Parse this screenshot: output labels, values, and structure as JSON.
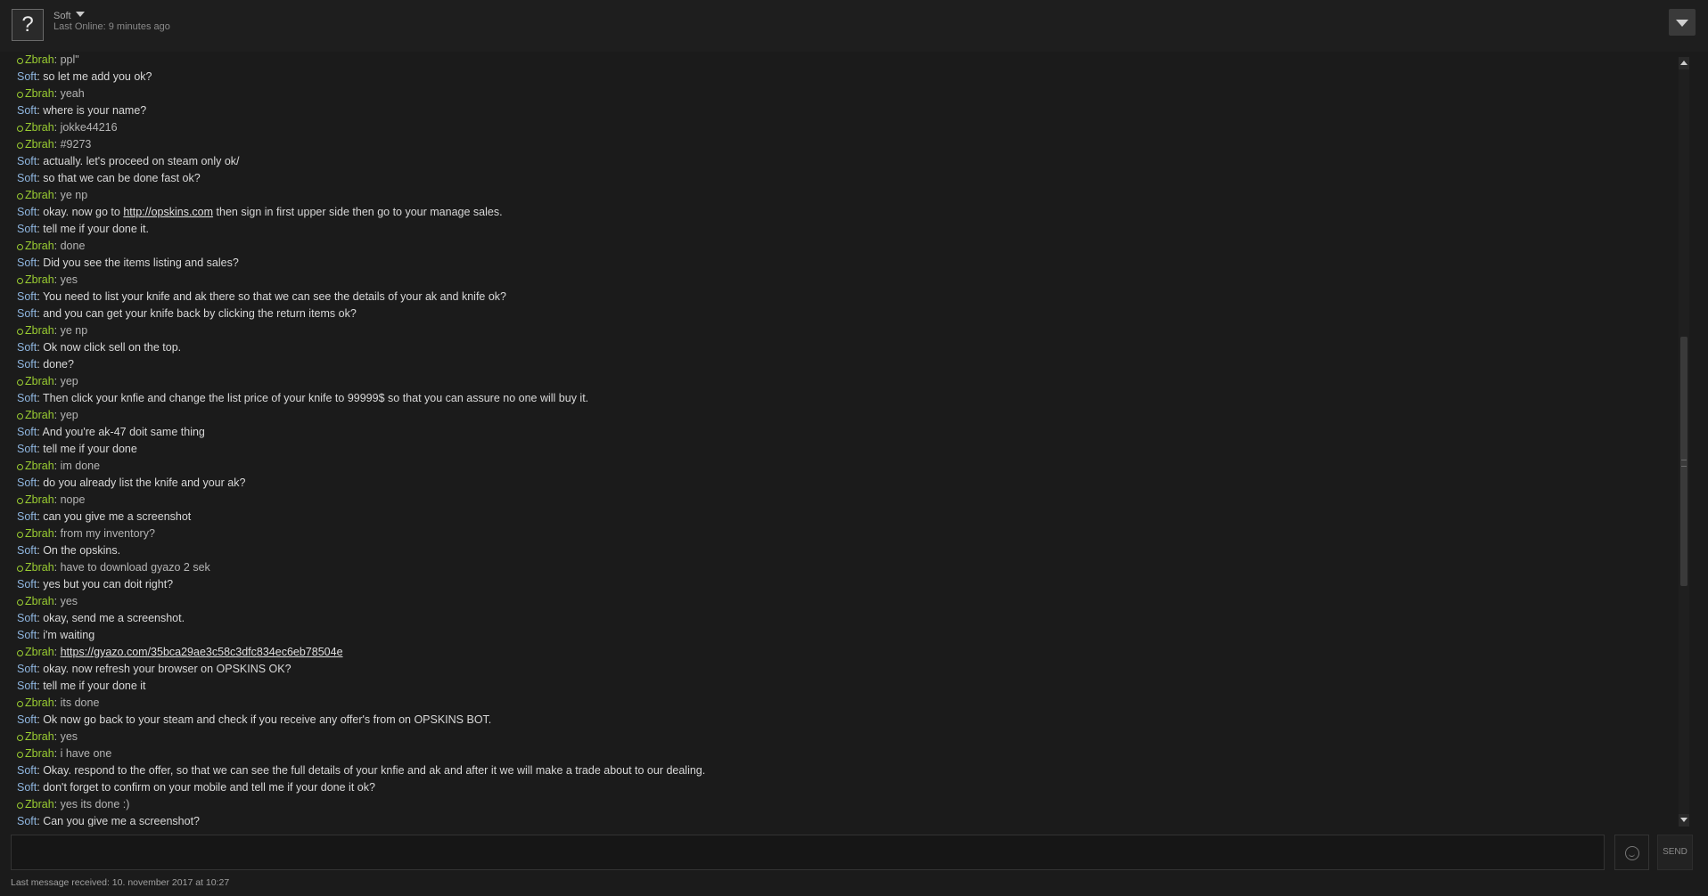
{
  "header": {
    "friend_name": "Soft",
    "last_online": "Last Online: 9 minutes ago",
    "avatar_glyph": "?"
  },
  "colors": {
    "background": "#1b1b1b",
    "sender_soft": "#8fb6e0",
    "sender_zbrah": "#9acd32",
    "text": "#d8d8d8"
  },
  "messages": [
    {
      "sender": "Zbrah",
      "text": "ppl\""
    },
    {
      "sender": "Soft",
      "text": "so let me add you ok?"
    },
    {
      "sender": "Zbrah",
      "text": "yeah"
    },
    {
      "sender": "Soft",
      "text": "where is your name?"
    },
    {
      "sender": "Zbrah",
      "text": "jokke44216"
    },
    {
      "sender": "Zbrah",
      "text": "#9273"
    },
    {
      "sender": "Soft",
      "text": "actually. let's proceed on steam only ok/"
    },
    {
      "sender": "Soft",
      "text": "so that we can be done fast ok?"
    },
    {
      "sender": "Zbrah",
      "text": "ye np"
    },
    {
      "sender": "Soft",
      "pre": "okay. now go to ",
      "link": "http://opskins.com",
      "post": " then sign in first upper side then go to your manage sales."
    },
    {
      "sender": "Soft",
      "text": "tell me if your done it."
    },
    {
      "sender": "Zbrah",
      "text": "done"
    },
    {
      "sender": "Soft",
      "text": "Did you see the items listing and sales?"
    },
    {
      "sender": "Zbrah",
      "text": "yes"
    },
    {
      "sender": "Soft",
      "text": "You need to list your knife and ak there so that we can see the details of your ak and knife ok?"
    },
    {
      "sender": "Soft",
      "text": "and you can get your knife back by clicking the return items ok?"
    },
    {
      "sender": "Zbrah",
      "text": "ye np"
    },
    {
      "sender": "Soft",
      "text": "Ok now click sell on the top."
    },
    {
      "sender": "Soft",
      "text": "done?"
    },
    {
      "sender": "Zbrah",
      "text": "yep"
    },
    {
      "sender": "Soft",
      "text": "Then click your knfie and change the list price of your knife to 99999$ so that you can assure no one will buy it."
    },
    {
      "sender": "Zbrah",
      "text": "yep"
    },
    {
      "sender": "Soft",
      "text": "And you're ak-47 doit same thing"
    },
    {
      "sender": "Soft",
      "text": "tell me if your done"
    },
    {
      "sender": "Zbrah",
      "text": "im done"
    },
    {
      "sender": "Soft",
      "text": "do you already list the knife and your ak?"
    },
    {
      "sender": "Zbrah",
      "text": "nope"
    },
    {
      "sender": "Soft",
      "text": "can you give me a screenshot"
    },
    {
      "sender": "Zbrah",
      "text": "from my inventory?"
    },
    {
      "sender": "Soft",
      "text": "On the opskins."
    },
    {
      "sender": "Zbrah",
      "text": "have to download gyazo 2 sek"
    },
    {
      "sender": "Soft",
      "text": "yes but you can doit right?"
    },
    {
      "sender": "Zbrah",
      "text": "yes"
    },
    {
      "sender": "Soft",
      "text": "okay, send me a screenshot."
    },
    {
      "sender": "Soft",
      "text": "i'm waiting"
    },
    {
      "sender": "Zbrah",
      "pre": "",
      "link": "https://gyazo.com/35bca29ae3c58c3dfc834ec6eb78504e",
      "post": ""
    },
    {
      "sender": "Soft",
      "text": "okay. now refresh your browser on OPSKINS OK?"
    },
    {
      "sender": "Soft",
      "text": "tell me if your done it"
    },
    {
      "sender": "Zbrah",
      "text": "its done"
    },
    {
      "sender": "Soft",
      "text": "Ok now go back to your steam and check if you receive any offer's from on OPSKINS BOT."
    },
    {
      "sender": "Zbrah",
      "text": "yes"
    },
    {
      "sender": "Zbrah",
      "text": "i have one"
    },
    {
      "sender": "Soft",
      "text": "Okay. respond to the offer, so that we can see the full details of your knfie and ak and after it we will make a trade about to our dealing."
    },
    {
      "sender": "Soft",
      "text": "don't forget to confirm on your mobile and tell me if your done it ok?"
    },
    {
      "sender": "Zbrah",
      "text": "yes its done :)"
    },
    {
      "sender": "Soft",
      "text": "Can you give me a screenshot?"
    }
  ],
  "composer": {
    "input_value": "",
    "emoji_icon": "smiley-icon",
    "send_label": "SEND"
  },
  "footer": {
    "status": "Last message received: 10. november 2017 at 10:27"
  }
}
